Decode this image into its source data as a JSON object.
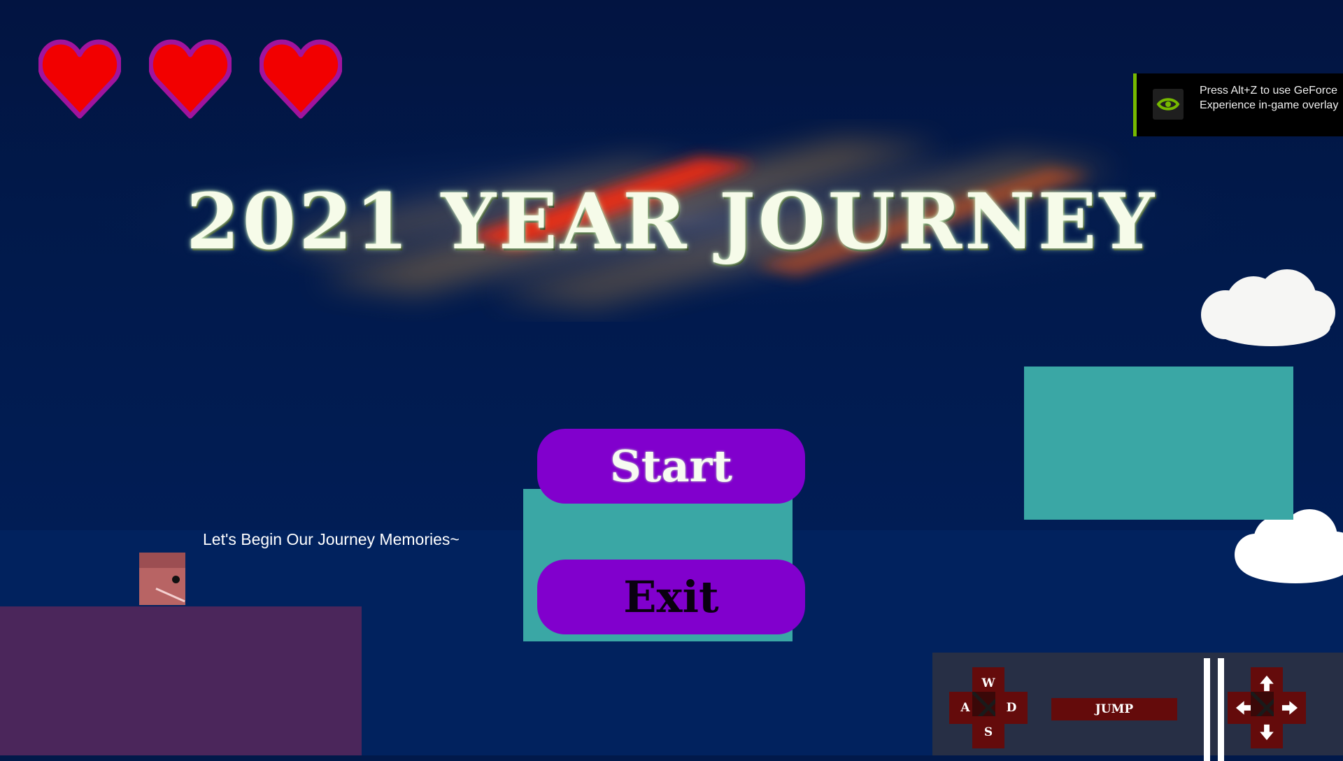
{
  "hud": {
    "lives": 3,
    "heart_icon": "heart-icon",
    "heart_fill": "#f20000",
    "heart_outline": "#a0149e"
  },
  "title": {
    "text": "2021 YEAR JOURNEY"
  },
  "overlay": {
    "text": "Press Alt+Z to use GeForce Experience in-game overlay",
    "logo_icon": "nvidia-logo-icon",
    "accent": "#76b900"
  },
  "menu": {
    "start_label": "Start",
    "exit_label": "Exit",
    "button_color": "#8100cd"
  },
  "tagline": "Let's Begin Our Journey Memories~",
  "controls": {
    "keys": {
      "up": "W",
      "left": "A",
      "right": "D",
      "down": "S"
    },
    "jump_label": "JUMP",
    "arrows": [
      "arrow-up-icon",
      "arrow-left-icon",
      "arrow-right-icon",
      "arrow-down-icon"
    ],
    "pause_icon": "pause-icon",
    "key_color": "#640b0b"
  },
  "colors": {
    "background": "#01194a",
    "teal_block": "#3aa7a5",
    "platform": "#4b265b"
  }
}
